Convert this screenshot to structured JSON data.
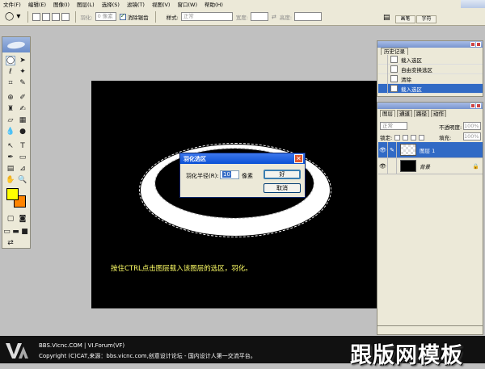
{
  "menu": {
    "items": [
      "文件(F)",
      "编辑(E)",
      "图像(I)",
      "图层(L)",
      "选择(S)",
      "滤镜(T)",
      "视图(V)",
      "窗口(W)",
      "帮助(H)"
    ]
  },
  "options": {
    "feather_label": "羽化:",
    "feather_value": "0 像素",
    "antialias_label": "消除锯齿",
    "style_label": "样式:",
    "style_value": "正常",
    "width_label": "宽度:",
    "height_label": "高度:",
    "palette_tabs": [
      "画笔",
      "字符"
    ]
  },
  "canvas": {
    "caption": "按住CTRL点击图层载入该图层的选区，羽化。"
  },
  "dialog": {
    "title": "羽化选区",
    "radius_label": "羽化半径(R):",
    "radius_value": "10",
    "unit": "像素",
    "ok": "好",
    "cancel": "取消"
  },
  "history": {
    "tab": "历史记录",
    "items": [
      {
        "label": "载入选区",
        "selected": false
      },
      {
        "label": "自由变换选区",
        "selected": false
      },
      {
        "label": "清除",
        "selected": false
      },
      {
        "label": "载入选区",
        "selected": true
      }
    ]
  },
  "layers": {
    "tabs": [
      "图层",
      "通道",
      "路径",
      "动作"
    ],
    "blend_mode": "正常",
    "opacity_label": "不透明度:",
    "opacity_value": "100%",
    "lock_label": "锁定:",
    "fill_label": "填充:",
    "fill_value": "100%",
    "rows": [
      {
        "name": "图层 1",
        "selected": true
      },
      {
        "name": "背景",
        "selected": false
      }
    ]
  },
  "footer": {
    "line1": "BBS.VIcnc.COM  |  VI.Forum(VF)",
    "line2": "Copyright (C)CAT,来源：bbs.vicnc.com,创意设计论坛 - 国内设计人第一交流平台。",
    "watermark": "跟版网模板"
  },
  "colors": {
    "foreground": "#ffff00",
    "background": "#ff8400",
    "selection": "#316ac5",
    "caption": "#ffff66"
  }
}
